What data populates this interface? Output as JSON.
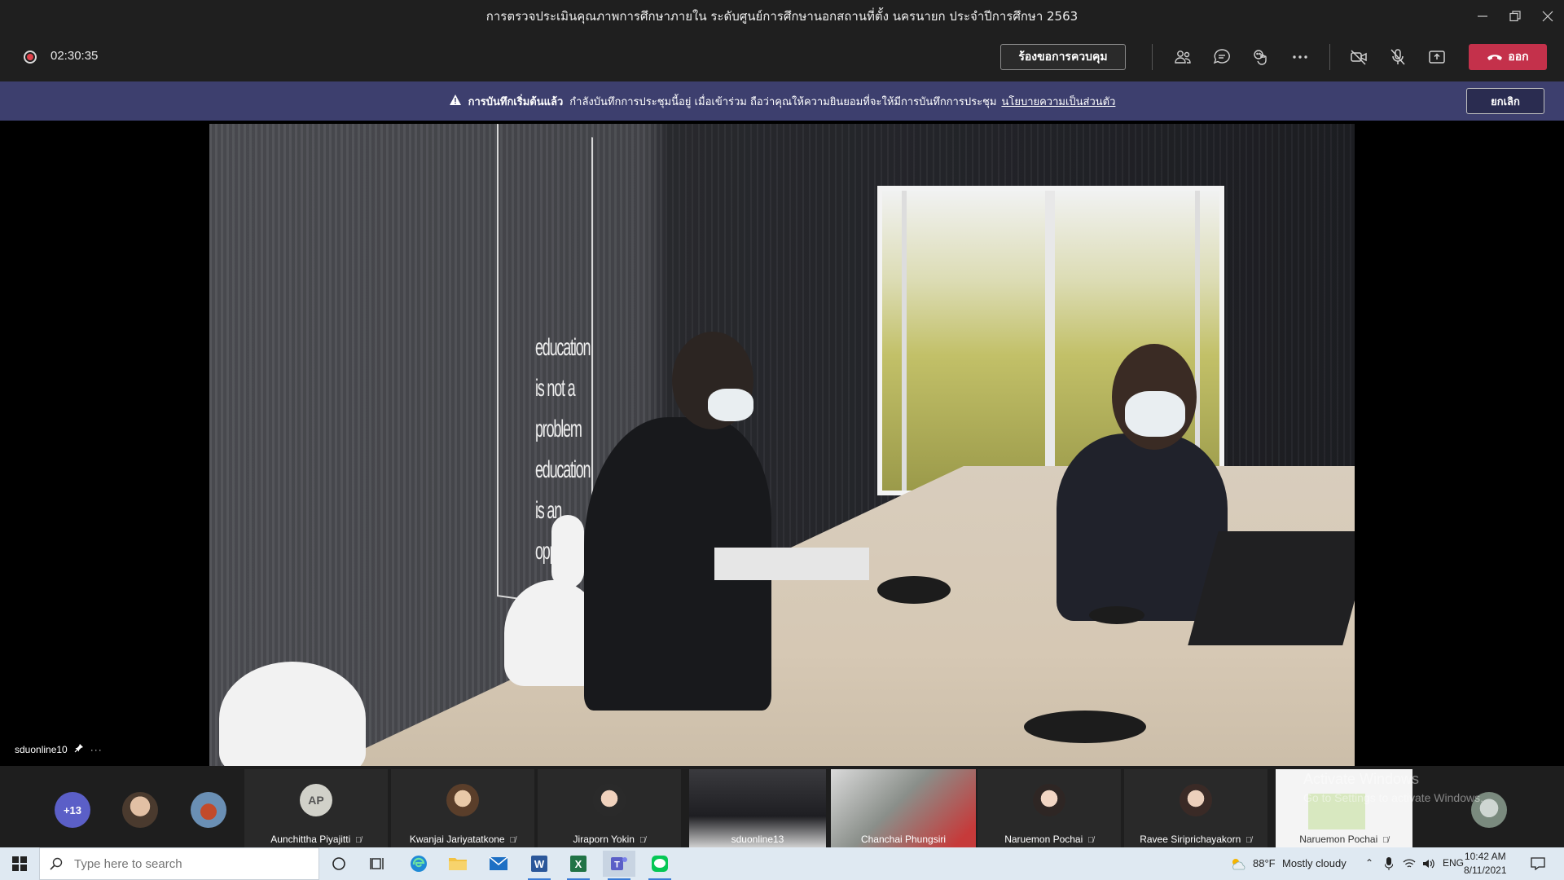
{
  "window": {
    "title": "การตรวจประเมินคุณภาพการศึกษาภายใน ระดับศูนย์การศึกษานอกสถานที่ตั้ง นครนายก ประจำปีการศึกษา 2563"
  },
  "toolbar": {
    "timer": "02:30:35",
    "request_control_label": "ร้องขอการควบคุม",
    "leave_label": "ออก"
  },
  "banner": {
    "heading": "การบันทึกเริ่มต้นแล้ว",
    "message": "กำลังบันทึกการประชุมนี้อยู่ เมื่อเข้าร่วม ถือว่าคุณให้ความยินยอมที่จะให้มีการบันทึกการประชุม",
    "policy_link": "นโยบายความเป็นส่วนตัว",
    "dismiss_label": "ยกเลิก"
  },
  "main_video": {
    "participant": "sduonline10",
    "wall_text": "education\nis not a\nproblem\neducation\nis an\nopp"
  },
  "participants": {
    "overflow_count": "+13",
    "tiles": [
      {
        "name": "Aunchittha Piyajitti",
        "initials": "AP"
      },
      {
        "name": "Kwanjai Jariyatatkone"
      },
      {
        "name": "Jiraporn Yokin"
      },
      {
        "name": "sduonline13"
      },
      {
        "name": "Chanchai Phungsiri"
      },
      {
        "name": "Naruemon Pochai"
      },
      {
        "name": "Ravee Siriprichayakorn"
      },
      {
        "name": "Naruemon Pochai"
      }
    ]
  },
  "watermark": {
    "title": "Activate Windows",
    "subtitle": "Go to Settings to activate Windows."
  },
  "taskbar": {
    "search_placeholder": "Type here to search",
    "weather_temp": "88°F",
    "weather_desc": "Mostly cloudy",
    "language": "ENG",
    "time": "10:42 AM",
    "date": "8/11/2021"
  },
  "colors": {
    "leave_red": "#c4314b",
    "banner_bg": "#3d3f6e",
    "avatar_purple": "#5b5fc7",
    "taskbar_bg": "#dfe9f2"
  }
}
